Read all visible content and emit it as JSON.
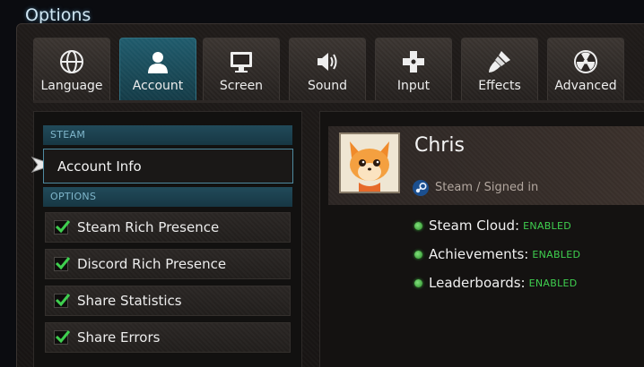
{
  "window": {
    "title": "Options"
  },
  "tabs": [
    {
      "label": "Language",
      "icon": "globe-icon"
    },
    {
      "label": "Account",
      "icon": "user-icon",
      "active": true
    },
    {
      "label": "Screen",
      "icon": "monitor-icon"
    },
    {
      "label": "Sound",
      "icon": "speaker-icon"
    },
    {
      "label": "Input",
      "icon": "dpad-icon"
    },
    {
      "label": "Effects",
      "icon": "brush-icon"
    },
    {
      "label": "Advanced",
      "icon": "radiation-icon"
    }
  ],
  "sidebar": {
    "steam_header": "STEAM",
    "account_item": "Account Info",
    "options_header": "OPTIONS",
    "options": [
      {
        "label": "Steam Rich Presence",
        "checked": true
      },
      {
        "label": "Discord Rich Presence",
        "checked": true
      },
      {
        "label": "Share Statistics",
        "checked": true
      },
      {
        "label": "Share Errors",
        "checked": true
      }
    ]
  },
  "profile": {
    "name": "Chris",
    "status": "Steam / Signed in",
    "features": [
      {
        "name": "Steam Cloud:",
        "value": "ENABLED"
      },
      {
        "name": "Achievements:",
        "value": "ENABLED"
      },
      {
        "name": "Leaderboards:",
        "value": "ENABLED"
      }
    ]
  },
  "colors": {
    "accent_teal": "#1f5b6c",
    "enabled_green": "#3fcf4f",
    "section_header_text": "#7fb6cb"
  }
}
